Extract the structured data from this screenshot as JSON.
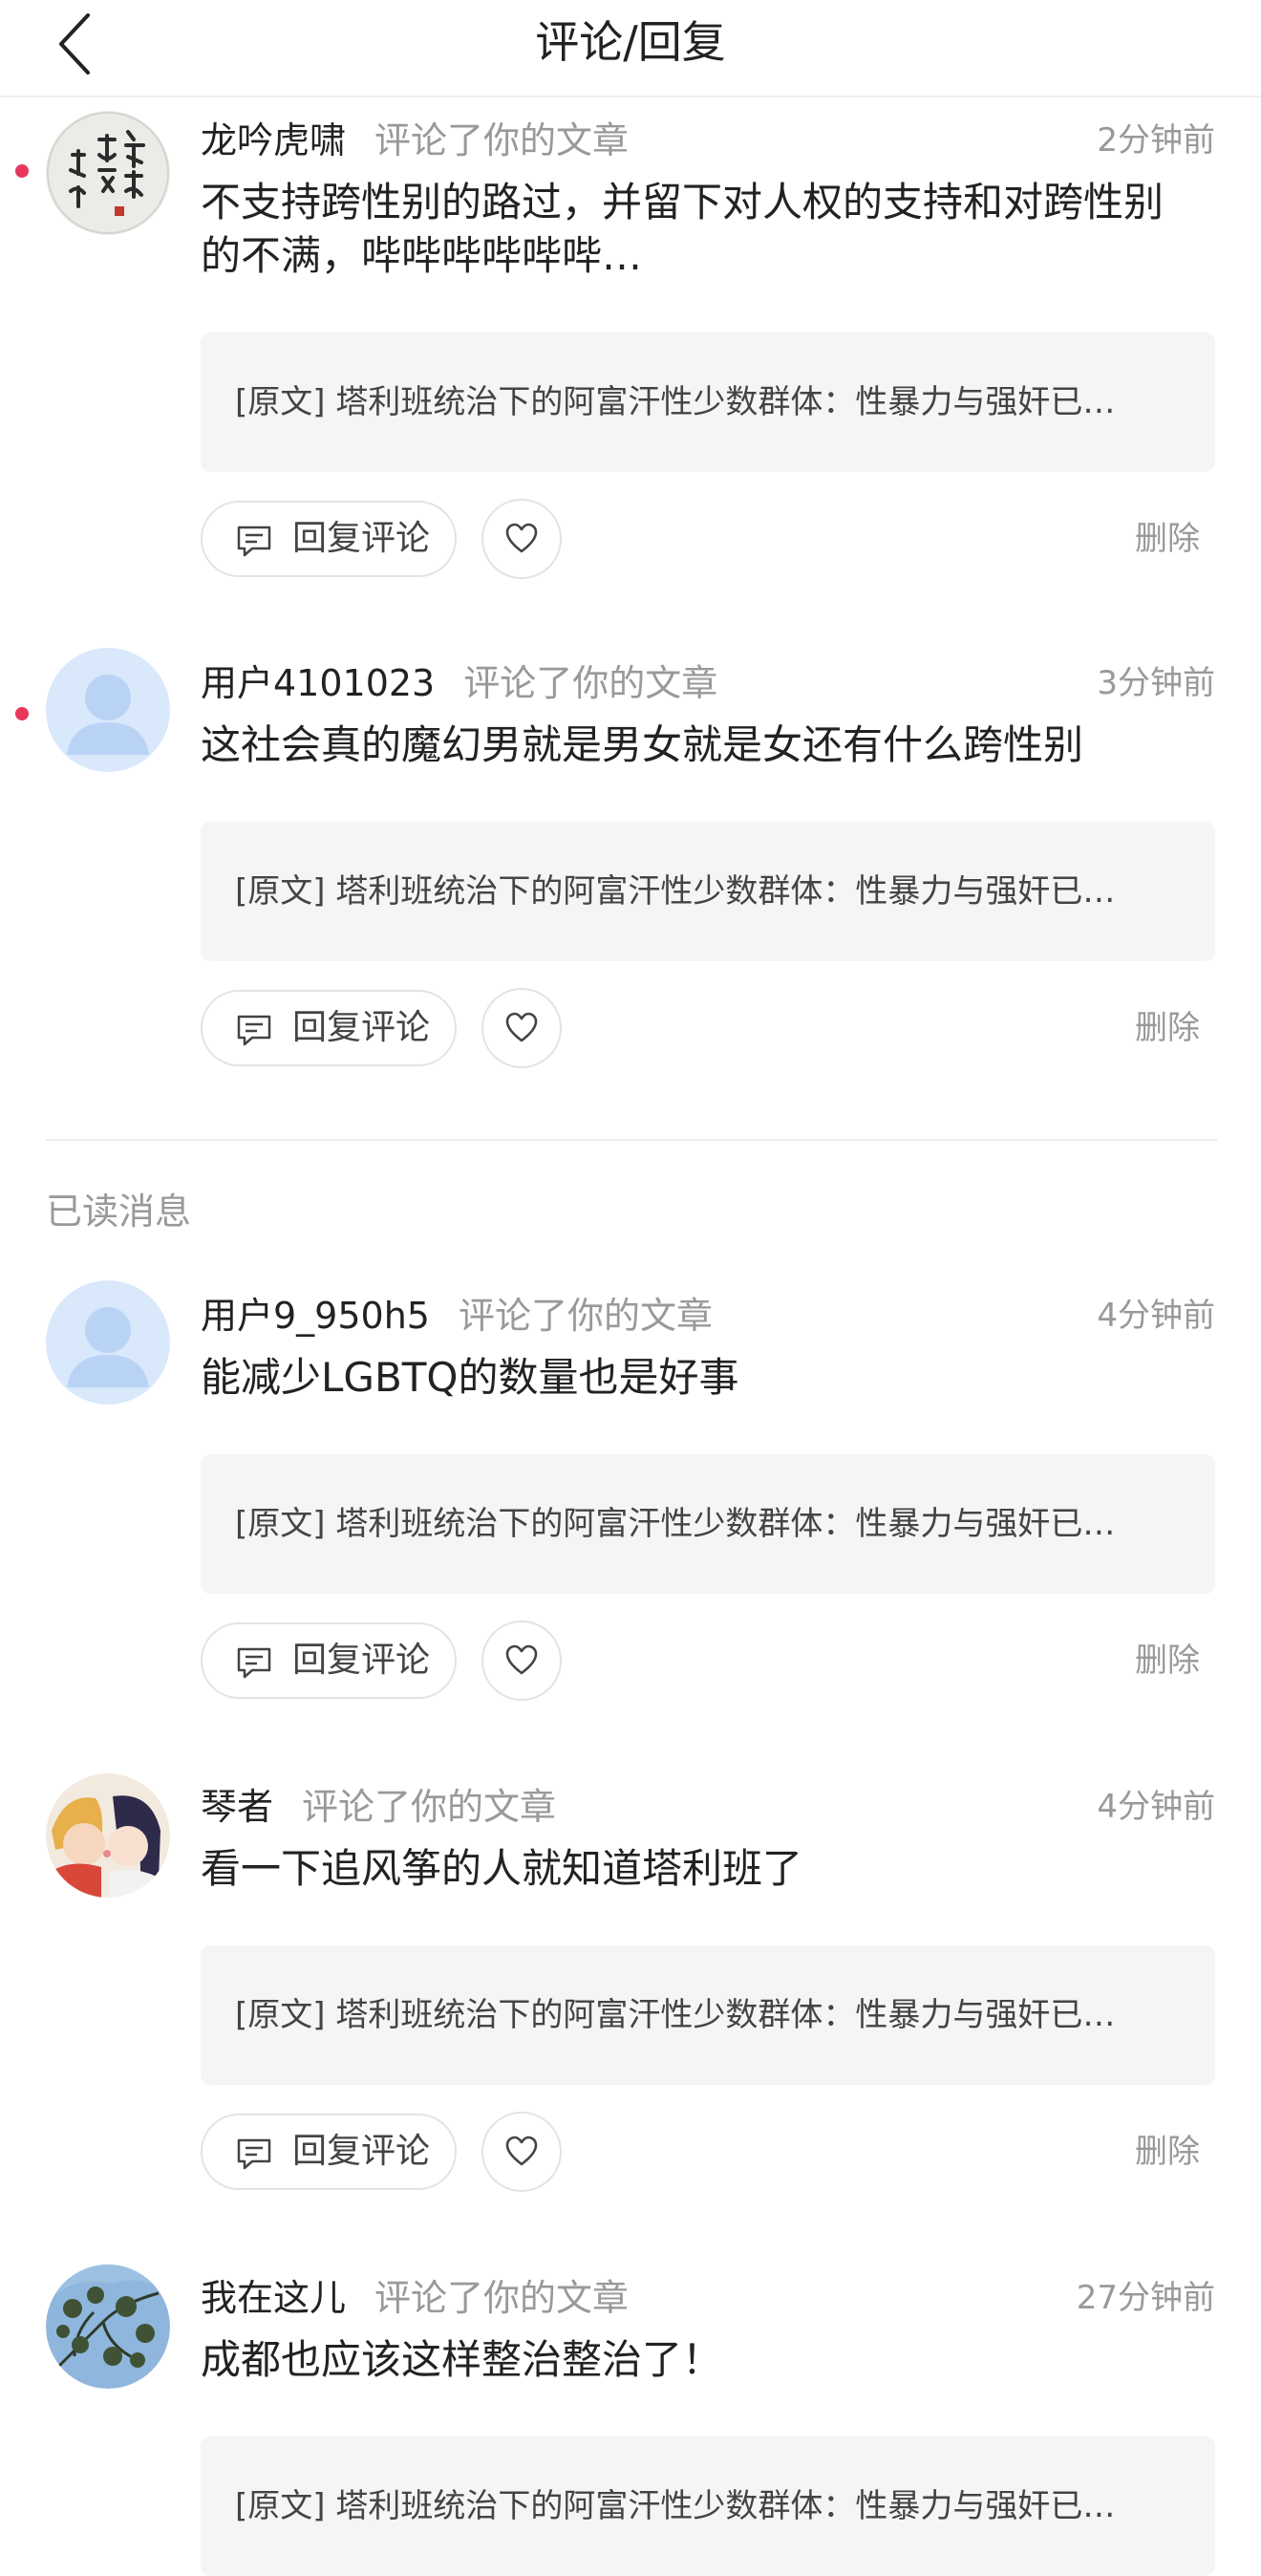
{
  "navbar": {
    "title": "评论/回复"
  },
  "section": {
    "read_label": "已读消息"
  },
  "quote_text": "[原文] 塔利班统治下的阿富汗性少数群体：性暴力与强奸已…",
  "labels": {
    "reply": "回复评论",
    "delete": "删除"
  },
  "colors": {
    "unread_dot": "#e8375b",
    "muted": "#999999",
    "quote_bg": "#f5f5f5"
  },
  "comments": [
    {
      "username": "龙吟虎啸",
      "action": "评论了你的文章",
      "time": "2分钟前",
      "text": "不支持跨性别的路过，并留下对人权的支持和对跨性别的不满，哔哔哔哔哔哔…",
      "unread": true,
      "avatar": "calligraphy-avatar"
    },
    {
      "username": "用户4101023",
      "action": "评论了你的文章",
      "time": "3分钟前",
      "text": "这社会真的魔幻男就是男女就是女还有什么跨性别",
      "unread": true,
      "avatar": "default-user-avatar"
    },
    {
      "username": "用户9_950h5",
      "action": "评论了你的文章",
      "time": "4分钟前",
      "text": "能减少LGBTQ的数量也是好事",
      "unread": false,
      "avatar": "default-user-avatar"
    },
    {
      "username": "琴者",
      "action": "评论了你的文章",
      "time": "4分钟前",
      "text": "看一下追风筝的人就知道塔利班了",
      "unread": false,
      "avatar": "anime-couple-avatar"
    },
    {
      "username": "我在这儿",
      "action": "评论了你的文章",
      "time": "27分钟前",
      "text": "成都也应该这样整治整治了！",
      "unread": false,
      "avatar": "tree-sky-avatar"
    }
  ]
}
